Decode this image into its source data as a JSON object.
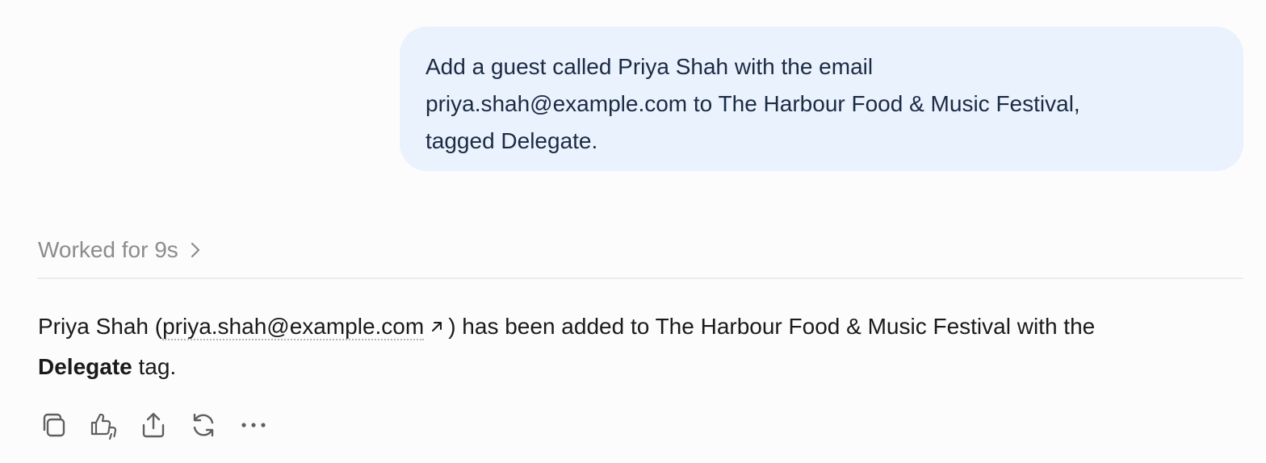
{
  "user_message": {
    "line1": "Add a guest called Priya Shah with the email",
    "line2": "priya.shah@example.com to The Harbour Food & Music Festival,",
    "line3": "tagged Delegate."
  },
  "status": {
    "worked_label": "Worked for 9s",
    "chevron_icon": "chevron-right-icon"
  },
  "assistant_message": {
    "prefix": "Priya Shah (",
    "email_link": "priya.shah@example.com",
    "link_icon": "arrow-up-right-icon",
    "middle": ") has been added to The Harbour Food & Music Festival with the",
    "tag_name": "Delegate",
    "suffix": " tag."
  },
  "actions": [
    {
      "icon": "copy-icon"
    },
    {
      "icon": "thumbs-up-down-icon"
    },
    {
      "icon": "share-icon"
    },
    {
      "icon": "regenerate-icon"
    },
    {
      "icon": "more-icon"
    }
  ]
}
